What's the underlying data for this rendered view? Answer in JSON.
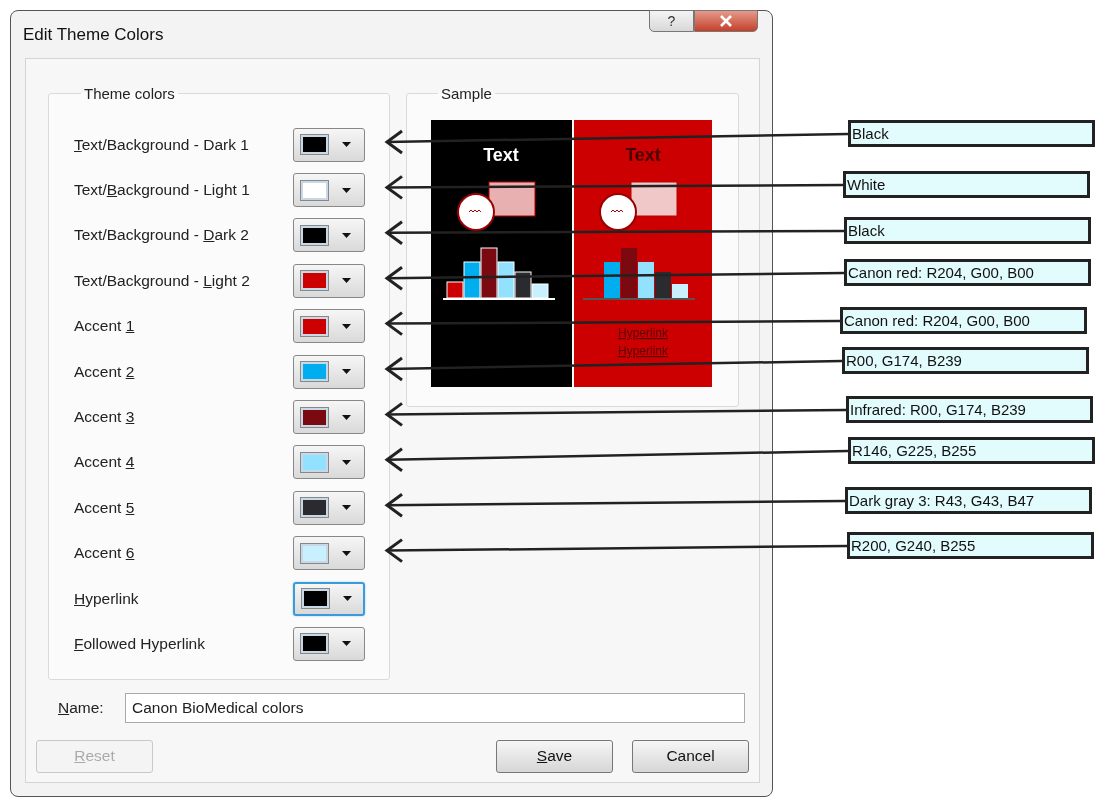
{
  "window": {
    "title": "Edit Theme Colors",
    "help_button": "?"
  },
  "theme_colors": {
    "legend": "Theme colors",
    "items": [
      {
        "key": "T",
        "post": "ext/Background - Dark 1",
        "color": "#000000",
        "focused": false
      },
      {
        "pre": "Text/",
        "key": "B",
        "post": "ackground - Light 1",
        "color": "#ffffff",
        "focused": false
      },
      {
        "pre": "Text/Background - ",
        "key": "D",
        "post": "ark 2",
        "color": "#000000",
        "focused": false
      },
      {
        "pre": "Text/Background - ",
        "key": "L",
        "post": "ight 2",
        "color": "#cc0000",
        "focused": false
      },
      {
        "pre": "Accent ",
        "key": "1",
        "color": "#cc0000",
        "focused": false
      },
      {
        "pre": "Accent ",
        "key": "2",
        "color": "#00aeef",
        "focused": false
      },
      {
        "pre": "Accent ",
        "key": "3",
        "color": "#7a0a10",
        "focused": false
      },
      {
        "pre": "Accent ",
        "key": "4",
        "color": "#92e1ff",
        "focused": false
      },
      {
        "pre": "Accent ",
        "key": "5",
        "color": "#2b2b2f",
        "focused": false
      },
      {
        "pre": "Accent ",
        "key": "6",
        "color": "#c8f0ff",
        "focused": false
      },
      {
        "key": "H",
        "post": "yperlink",
        "color": "#000000",
        "focused": true
      },
      {
        "key": "F",
        "post": "ollowed Hyperlink",
        "color": "#000000",
        "focused": false
      }
    ]
  },
  "sample": {
    "legend": "Sample",
    "panels": [
      {
        "heading": "Text"
      },
      {
        "heading": "Text",
        "links": [
          "Hyperlink",
          "Hyperlink"
        ]
      }
    ]
  },
  "name": {
    "label": {
      "key": "N",
      "post": "ame:"
    },
    "value": "Canon BioMedical colors"
  },
  "buttons": [
    {
      "key": "R",
      "post": "eset",
      "disabled": true
    },
    {
      "key": "S",
      "post": "ave",
      "disabled": false
    },
    {
      "pre": "Cancel",
      "disabled": false
    }
  ],
  "annotations": [
    {
      "text": "Black"
    },
    {
      "text": "White"
    },
    {
      "text": "Black"
    },
    {
      "text": "Canon red: R204, G00, B00"
    },
    {
      "text": "Canon red: R204, G00, B00"
    },
    {
      "text": "R00, G174, B239"
    },
    {
      "text": "Infrared: R00, G174, B239"
    },
    {
      "text": "R146, G225, B255"
    },
    {
      "text": "Dark gray 3: R43, G43, B47"
    },
    {
      "text": "R200, G240, B255"
    }
  ]
}
